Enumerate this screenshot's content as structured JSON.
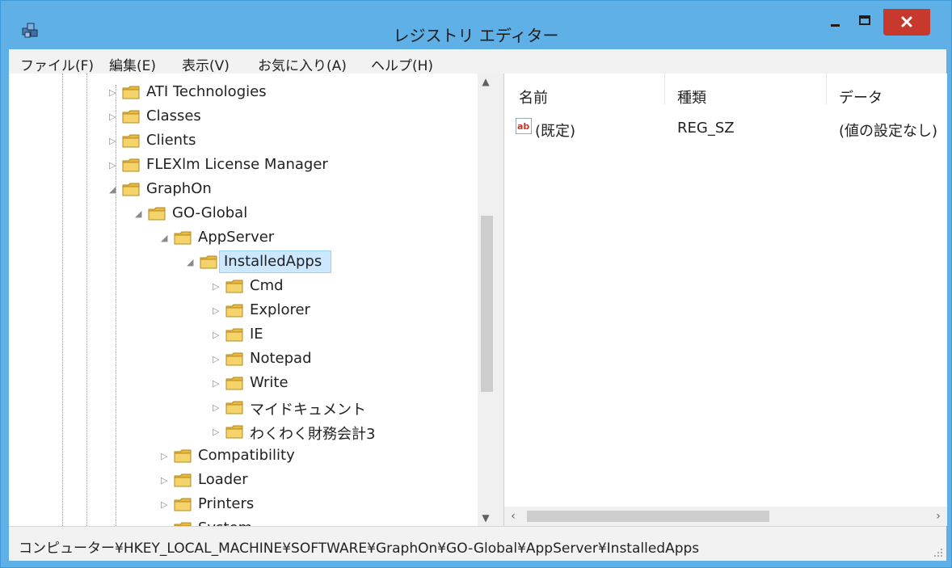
{
  "window": {
    "title": "レジストリ エディター"
  },
  "menu": [
    "ファイル(F)",
    "編集(E)",
    "表示(V)",
    "お気に入り(A)",
    "ヘルプ(H)"
  ],
  "tree": [
    {
      "label": "ATI Technologies",
      "level": 0,
      "expanded": false
    },
    {
      "label": "Classes",
      "level": 0,
      "expanded": false
    },
    {
      "label": "Clients",
      "level": 0,
      "expanded": false
    },
    {
      "label": "FLEXlm License Manager",
      "level": 0,
      "expanded": false
    },
    {
      "label": "GraphOn",
      "level": 0,
      "expanded": true
    },
    {
      "label": "GO-Global",
      "level": 1,
      "expanded": true
    },
    {
      "label": "AppServer",
      "level": 2,
      "expanded": true
    },
    {
      "label": "InstalledApps",
      "level": 3,
      "expanded": true,
      "selected": true
    },
    {
      "label": "Cmd",
      "level": 4,
      "expanded": false
    },
    {
      "label": "Explorer",
      "level": 4,
      "expanded": false
    },
    {
      "label": "IE",
      "level": 4,
      "expanded": false
    },
    {
      "label": "Notepad",
      "level": 4,
      "expanded": false
    },
    {
      "label": "Write",
      "level": 4,
      "expanded": false
    },
    {
      "label": "マイドキュメント",
      "level": 4,
      "expanded": false
    },
    {
      "label": "わくわく財務会計3",
      "level": 4,
      "expanded": false
    },
    {
      "label": "Compatibility",
      "level": 2,
      "expanded": false
    },
    {
      "label": "Loader",
      "level": 2,
      "expanded": false
    },
    {
      "label": "Printers",
      "level": 2,
      "expanded": false
    },
    {
      "label": "System",
      "level": 2,
      "expanded": false
    }
  ],
  "list": {
    "columns": [
      "名前",
      "種類",
      "データ"
    ],
    "rows": [
      {
        "name": "(既定)",
        "type": "REG_SZ",
        "data": "(値の設定なし)",
        "icon": "string-value-icon"
      }
    ]
  },
  "status": {
    "path": "コンピューター¥HKEY_LOCAL_MACHINE¥SOFTWARE¥GraphOn¥GO-Global¥AppServer¥InstalledApps"
  },
  "colors": {
    "titlebar": "#5eb0e6",
    "close": "#c7392c",
    "selection": "#cce8ff",
    "folder": "#e8b93c"
  }
}
